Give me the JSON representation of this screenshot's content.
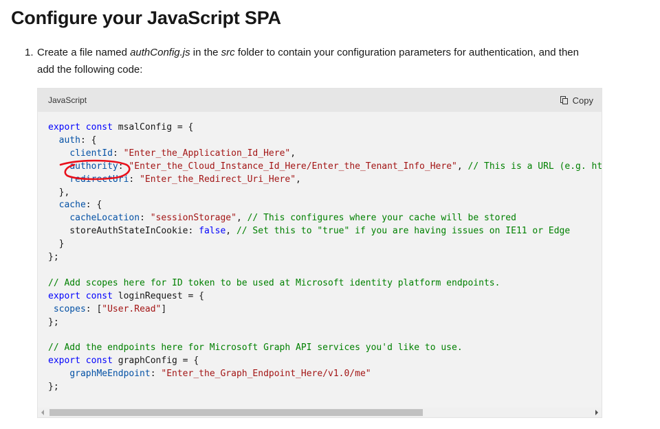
{
  "page": {
    "title": "Configure your JavaScript SPA"
  },
  "step": {
    "number": "1.",
    "text_before_file": "Create a file named ",
    "file_name": "authConfig.js",
    "text_before_folder": " in the ",
    "folder_name": "src",
    "text_after_folder": " folder to contain your configuration parameters for authentication, and then add the following code:"
  },
  "code_block": {
    "language": "JavaScript",
    "copy_label": "Copy",
    "copy_icon": "copy-icon",
    "lines": [
      [
        {
          "t": "kw",
          "v": "export const"
        },
        {
          "t": "p",
          "v": " msalConfig = {"
        }
      ],
      [
        {
          "t": "p",
          "v": "  "
        },
        {
          "t": "prop",
          "v": "auth"
        },
        {
          "t": "p",
          "v": ": {"
        }
      ],
      [
        {
          "t": "p",
          "v": "    "
        },
        {
          "t": "prop",
          "v": "clientId"
        },
        {
          "t": "p",
          "v": ": "
        },
        {
          "t": "str",
          "v": "\"Enter_the_Application_Id_Here\""
        },
        {
          "t": "p",
          "v": ","
        }
      ],
      [
        {
          "t": "p",
          "v": "    "
        },
        {
          "t": "prop",
          "v": "authority"
        },
        {
          "t": "p",
          "v": ": "
        },
        {
          "t": "str",
          "v": "\"Enter_the_Cloud_Instance_Id_Here/Enter_the_Tenant_Info_Here\""
        },
        {
          "t": "p",
          "v": ", "
        },
        {
          "t": "com",
          "v": "// This is a URL (e.g. https://login.microsoftonline.com/{your tenant ID})"
        }
      ],
      [
        {
          "t": "p",
          "v": "    "
        },
        {
          "t": "prop",
          "v": "redirectUri"
        },
        {
          "t": "p",
          "v": ": "
        },
        {
          "t": "str",
          "v": "\"Enter_the_Redirect_Uri_Here\""
        },
        {
          "t": "p",
          "v": ","
        }
      ],
      [
        {
          "t": "p",
          "v": "  },"
        }
      ],
      [
        {
          "t": "p",
          "v": "  "
        },
        {
          "t": "prop",
          "v": "cache"
        },
        {
          "t": "p",
          "v": ": {"
        }
      ],
      [
        {
          "t": "p",
          "v": "    "
        },
        {
          "t": "prop",
          "v": "cacheLocation"
        },
        {
          "t": "p",
          "v": ": "
        },
        {
          "t": "str",
          "v": "\"sessionStorage\""
        },
        {
          "t": "p",
          "v": ", "
        },
        {
          "t": "com",
          "v": "// This configures where your cache will be stored"
        }
      ],
      [
        {
          "t": "p",
          "v": "    storeAuthStateInCookie: "
        },
        {
          "t": "kw",
          "v": "false"
        },
        {
          "t": "p",
          "v": ", "
        },
        {
          "t": "com",
          "v": "// Set this to \"true\" if you are having issues on IE11 or Edge"
        }
      ],
      [
        {
          "t": "p",
          "v": "  }"
        }
      ],
      [
        {
          "t": "p",
          "v": "};"
        }
      ],
      [],
      [
        {
          "t": "com",
          "v": "// Add scopes here for ID token to be used at Microsoft identity platform endpoints."
        }
      ],
      [
        {
          "t": "kw",
          "v": "export const"
        },
        {
          "t": "p",
          "v": " loginRequest = {"
        }
      ],
      [
        {
          "t": "p",
          "v": " "
        },
        {
          "t": "prop",
          "v": "scopes"
        },
        {
          "t": "p",
          "v": ": ["
        },
        {
          "t": "str",
          "v": "\"User.Read\""
        },
        {
          "t": "p",
          "v": "]"
        }
      ],
      [
        {
          "t": "p",
          "v": "};"
        }
      ],
      [],
      [
        {
          "t": "com",
          "v": "// Add the endpoints here for Microsoft Graph API services you'd like to use."
        }
      ],
      [
        {
          "t": "kw",
          "v": "export const"
        },
        {
          "t": "p",
          "v": " graphConfig = {"
        }
      ],
      [
        {
          "t": "p",
          "v": "    "
        },
        {
          "t": "prop",
          "v": "graphMeEndpoint"
        },
        {
          "t": "p",
          "v": ": "
        },
        {
          "t": "str",
          "v": "\"Enter_the_Graph_Endpoint_Here/v1.0/me\""
        }
      ],
      [
        {
          "t": "p",
          "v": "};"
        }
      ]
    ]
  },
  "colors": {
    "keyword": "#0101fd",
    "string": "#a31515",
    "comment": "#008000",
    "property": "#0451a5",
    "annotation": "#e8101b"
  },
  "scrollbar": {
    "horizontal_position": 0
  }
}
